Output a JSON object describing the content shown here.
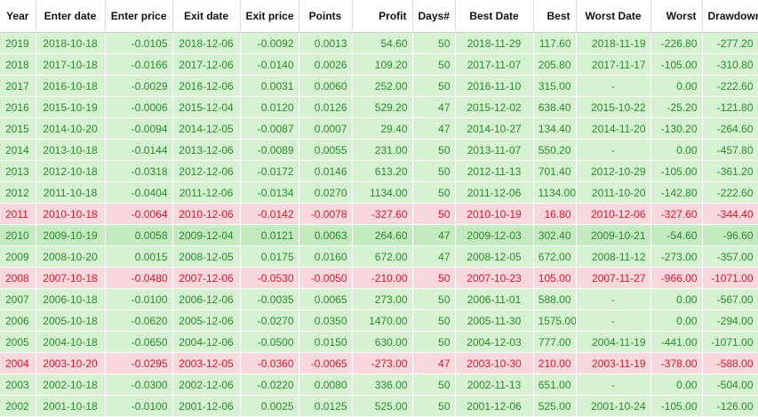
{
  "columns": [
    "Year",
    "Enter date",
    "Enter price",
    "Exit date",
    "Exit price",
    "Points",
    "Profit",
    "Days#",
    "Best Date",
    "Best",
    "Worst Date",
    "Worst",
    "Drawdown"
  ],
  "colors": {
    "win_bg": "#d6f2d3",
    "win_text": "#2b8a2b",
    "loss_bg": "#f8d7dd",
    "loss_text": "#d11a2a",
    "highlight_bg": "#c4eabf"
  },
  "rows": [
    {
      "status": "win",
      "cells": [
        "2019",
        "2018-10-18",
        "-0.0105",
        "2018-12-06",
        "-0.0092",
        "0.0013",
        "54.60",
        "50",
        "2018-11-29",
        "117.60",
        "2018-11-19",
        "-226.80",
        "-277.20"
      ]
    },
    {
      "status": "win",
      "cells": [
        "2018",
        "2017-10-18",
        "-0.0166",
        "2017-12-06",
        "-0.0140",
        "0.0026",
        "109.20",
        "50",
        "2017-11-07",
        "205.80",
        "2017-11-17",
        "-105.00",
        "-310.80"
      ]
    },
    {
      "status": "win",
      "cells": [
        "2017",
        "2016-10-18",
        "-0.0029",
        "2016-12-06",
        "0.0031",
        "0.0060",
        "252.00",
        "50",
        "2016-11-10",
        "315.00",
        "-",
        "0.00",
        "-222.60"
      ]
    },
    {
      "status": "win",
      "cells": [
        "2016",
        "2015-10-19",
        "-0.0006",
        "2015-12-04",
        "0.0120",
        "0.0126",
        "529.20",
        "47",
        "2015-12-02",
        "638.40",
        "2015-10-22",
        "-25.20",
        "-121.80"
      ]
    },
    {
      "status": "win",
      "cells": [
        "2015",
        "2014-10-20",
        "-0.0094",
        "2014-12-05",
        "-0.0087",
        "0.0007",
        "29.40",
        "47",
        "2014-10-27",
        "134.40",
        "2014-11-20",
        "-130.20",
        "-264.60"
      ]
    },
    {
      "status": "win",
      "cells": [
        "2014",
        "2013-10-18",
        "-0.0144",
        "2013-12-06",
        "-0.0089",
        "0.0055",
        "231.00",
        "50",
        "2013-11-07",
        "550.20",
        "-",
        "0.00",
        "-457.80"
      ]
    },
    {
      "status": "win",
      "cells": [
        "2013",
        "2012-10-18",
        "-0.0318",
        "2012-12-06",
        "-0.0172",
        "0.0146",
        "613.20",
        "50",
        "2012-11-13",
        "701.40",
        "2012-10-29",
        "-105.00",
        "-361.20"
      ]
    },
    {
      "status": "win",
      "cells": [
        "2012",
        "2011-10-18",
        "-0.0404",
        "2011-12-06",
        "-0.0134",
        "0.0270",
        "1134.00",
        "50",
        "2011-12-06",
        "1134.00",
        "2011-10-20",
        "-142.80",
        "-222.60"
      ]
    },
    {
      "status": "loss",
      "cells": [
        "2011",
        "2010-10-18",
        "-0.0064",
        "2010-12-06",
        "-0.0142",
        "-0.0078",
        "-327.60",
        "50",
        "2010-10-19",
        "16.80",
        "2010-12-06",
        "-327.60",
        "-344.40"
      ]
    },
    {
      "status": "highlight",
      "cells": [
        "2010",
        "2009-10-19",
        "0.0058",
        "2009-12-04",
        "0.0121",
        "0.0063",
        "264.60",
        "47",
        "2009-12-03",
        "302.40",
        "2009-10-21",
        "-54.60",
        "-96.60"
      ]
    },
    {
      "status": "win",
      "cells": [
        "2009",
        "2008-10-20",
        "0.0015",
        "2008-12-05",
        "0.0175",
        "0.0160",
        "672.00",
        "47",
        "2008-12-05",
        "672.00",
        "2008-11-12",
        "-273.00",
        "-357.00"
      ]
    },
    {
      "status": "loss",
      "cells": [
        "2008",
        "2007-10-18",
        "-0.0480",
        "2007-12-06",
        "-0.0530",
        "-0.0050",
        "-210.00",
        "50",
        "2007-10-23",
        "105.00",
        "2007-11-27",
        "-966.00",
        "-1071.00"
      ]
    },
    {
      "status": "win",
      "cells": [
        "2007",
        "2006-10-18",
        "-0.0100",
        "2006-12-06",
        "-0.0035",
        "0.0065",
        "273.00",
        "50",
        "2006-11-01",
        "588.00",
        "-",
        "0.00",
        "-567.00"
      ]
    },
    {
      "status": "win",
      "cells": [
        "2006",
        "2005-10-18",
        "-0.0620",
        "2005-12-06",
        "-0.0270",
        "0.0350",
        "1470.00",
        "50",
        "2005-11-30",
        "1575.00",
        "-",
        "0.00",
        "-294.00"
      ]
    },
    {
      "status": "win",
      "cells": [
        "2005",
        "2004-10-18",
        "-0.0650",
        "2004-12-06",
        "-0.0500",
        "0.0150",
        "630.00",
        "50",
        "2004-12-03",
        "777.00",
        "2004-11-19",
        "-441.00",
        "-1071.00"
      ]
    },
    {
      "status": "loss",
      "cells": [
        "2004",
        "2003-10-20",
        "-0.0295",
        "2003-12-05",
        "-0.0360",
        "-0.0065",
        "-273.00",
        "47",
        "2003-10-30",
        "210.00",
        "2003-11-19",
        "-378.00",
        "-588.00"
      ]
    },
    {
      "status": "win",
      "cells": [
        "2003",
        "2002-10-18",
        "-0.0300",
        "2002-12-06",
        "-0.0220",
        "0.0080",
        "336.00",
        "50",
        "2002-11-13",
        "651.00",
        "-",
        "0.00",
        "-504.00"
      ]
    },
    {
      "status": "win",
      "cells": [
        "2002",
        "2001-10-18",
        "-0.0100",
        "2001-12-06",
        "0.0025",
        "0.0125",
        "525.00",
        "50",
        "2001-12-06",
        "525.00",
        "2001-10-24",
        "-105.00",
        "-126.00"
      ]
    }
  ]
}
